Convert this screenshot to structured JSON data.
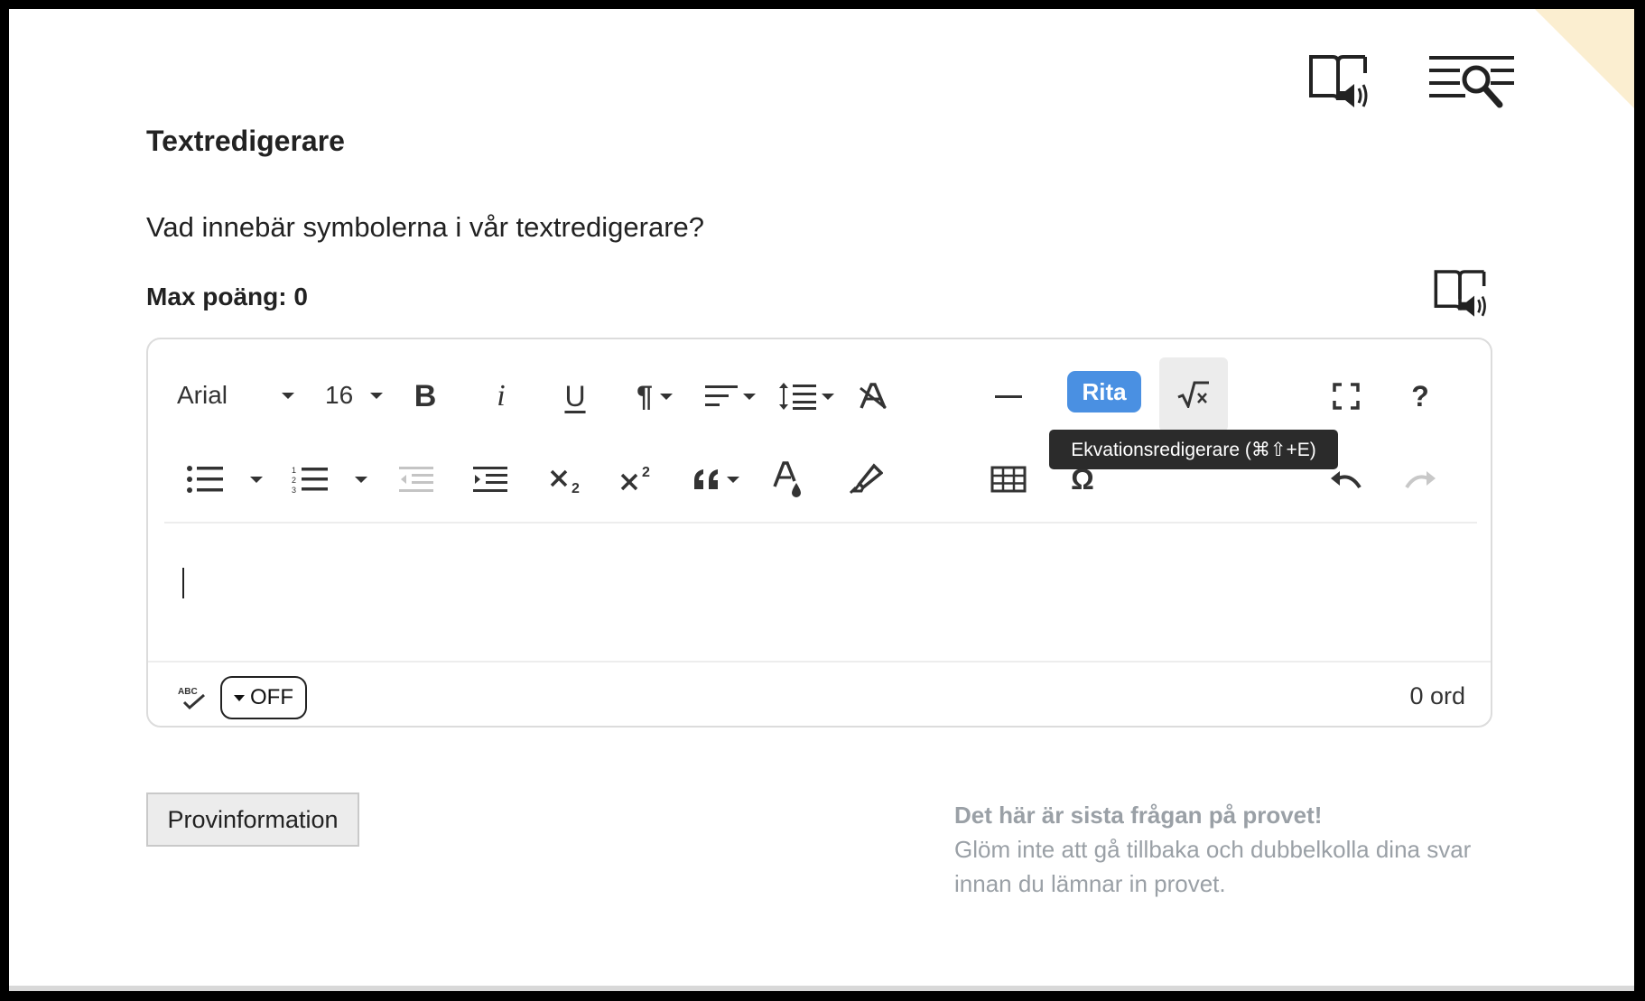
{
  "page": {
    "heading": "Textredigerare",
    "question": "Vad innebär symbolerna i vår textredigerare?",
    "max_points": "Max poäng: 0"
  },
  "top_icons": [
    "read-aloud-book-icon",
    "search-text-icon"
  ],
  "editor": {
    "font_family": "Arial",
    "font_size": "16",
    "draw_button": "Rita",
    "tooltip": "Ekvationsredigerare (⌘⇧+E)",
    "help": "?",
    "spellcheck_toggle": "OFF",
    "word_count": "0 ord",
    "accent_color": "#4a90e2"
  },
  "footer": {
    "info_button": "Provinformation",
    "last_question_title": "Det här är sista frågan på provet!",
    "last_question_text": "Glöm inte att gå tillbaka och dubbelkolla dina svar innan du lämnar in provet."
  }
}
